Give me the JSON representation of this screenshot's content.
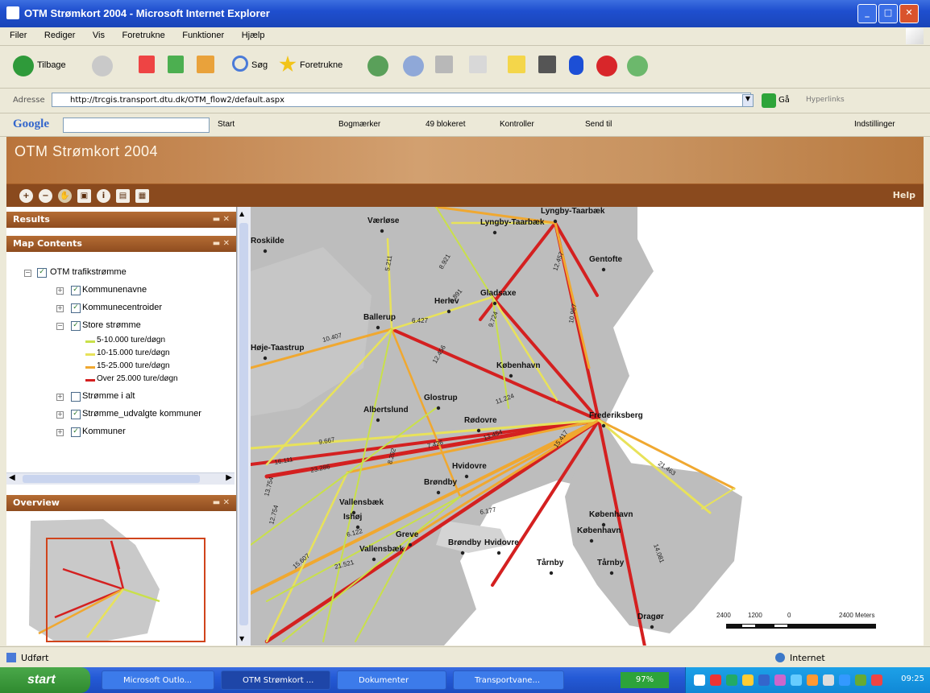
{
  "window": {
    "title": "OTM Strømkort 2004 - Microsoft Internet Explorer"
  },
  "menu": [
    "Filer",
    "Rediger",
    "Vis",
    "Foretrukne",
    "Funktioner",
    "Hjælp"
  ],
  "toolbar": {
    "back": "Tilbage",
    "search": "Søg",
    "favorites": "Foretrukne"
  },
  "address": {
    "label": "Adresse",
    "url": "http://trcgis.transport.dtu.dk/OTM_flow2/default.aspx",
    "go": "Gå",
    "links": "Hyperlinks"
  },
  "googlebar": {
    "logo": "Google",
    "start": "Start",
    "bookmarks": "Bogmærker",
    "blocked": "49 blokeret",
    "check": "Kontroller",
    "send": "Send til",
    "settings": "Indstillinger"
  },
  "app": {
    "title": "OTM Strømkort 2004",
    "help": "Help",
    "tools": [
      "+",
      "−",
      "✋",
      "▣",
      "i",
      "▤",
      "▦"
    ]
  },
  "panels": {
    "results": "Results",
    "map_contents": "Map Contents",
    "overview": "Overview",
    "ctrl": "▬ ✕"
  },
  "tree": {
    "root": "OTM trafikstrømme",
    "items": [
      {
        "label": "Kommunenavne",
        "checked": true
      },
      {
        "label": "Kommunecentroider",
        "checked": true
      },
      {
        "label": "Store strømme",
        "checked": true
      }
    ],
    "legend": [
      {
        "label": "5-10.000 ture/døgn",
        "color": "#c9e04a"
      },
      {
        "label": "10-15.000 ture/døgn",
        "color": "#e8e25a"
      },
      {
        "label": "15-25.000 ture/døgn",
        "color": "#f0a830"
      },
      {
        "label": "Over 25.000 ture/døgn",
        "color": "#d42020"
      }
    ],
    "items2": [
      {
        "label": "Strømme i alt",
        "checked": false
      },
      {
        "label": "Strømme_udvalgte kommuner",
        "checked": true
      },
      {
        "label": "Kommuner",
        "checked": true
      }
    ]
  },
  "map": {
    "places": [
      {
        "name": "Værløse"
      },
      {
        "name": "Lyngby-Taarbæk"
      },
      {
        "name": "Lyngby-Taarbæk"
      },
      {
        "name": "Gentofte"
      },
      {
        "name": "Herlev"
      },
      {
        "name": "Gladsaxe"
      },
      {
        "name": "Ballerup"
      },
      {
        "name": "Roskilde"
      },
      {
        "name": "Høje-Taastrup"
      },
      {
        "name": "København"
      },
      {
        "name": "Albertslund"
      },
      {
        "name": "Glostrup"
      },
      {
        "name": "Frederiksberg"
      },
      {
        "name": "Rødovre"
      },
      {
        "name": "Vallensbæk"
      },
      {
        "name": "Brøndby"
      },
      {
        "name": "Hvidovre"
      },
      {
        "name": "Ishøj"
      },
      {
        "name": "Greve"
      },
      {
        "name": "Vallensbæk"
      },
      {
        "name": "Brøndby"
      },
      {
        "name": "Hvidovre"
      },
      {
        "name": "Tårnby"
      },
      {
        "name": "København"
      },
      {
        "name": "København"
      },
      {
        "name": "Tårnby"
      },
      {
        "name": "Dragør"
      }
    ],
    "flow_labels": [
      "5.211",
      "6.427",
      "10.407",
      "8.921",
      "6.891",
      "13.754",
      "9.724",
      "9.667",
      "23.286",
      "16.111",
      "12.754",
      "8.202",
      "7.426",
      "6.122",
      "15.607",
      "21.521",
      "13.454",
      "11.224",
      "15.417",
      "21.463",
      "14.081",
      "6.177",
      "12.456",
      "10.957",
      "12.457"
    ],
    "scale": {
      "labels": [
        "2400",
        "1200",
        "0",
        "2400 Meters"
      ]
    }
  },
  "status": {
    "text": "Udført",
    "zone": "Internet"
  },
  "taskbar": {
    "start": "start",
    "tasks": [
      "Microsoft Outlo...",
      "OTM Strømkort ...",
      "Dokumenter",
      "Transportvane..."
    ],
    "clock": "09:25",
    "badge": "97%"
  }
}
